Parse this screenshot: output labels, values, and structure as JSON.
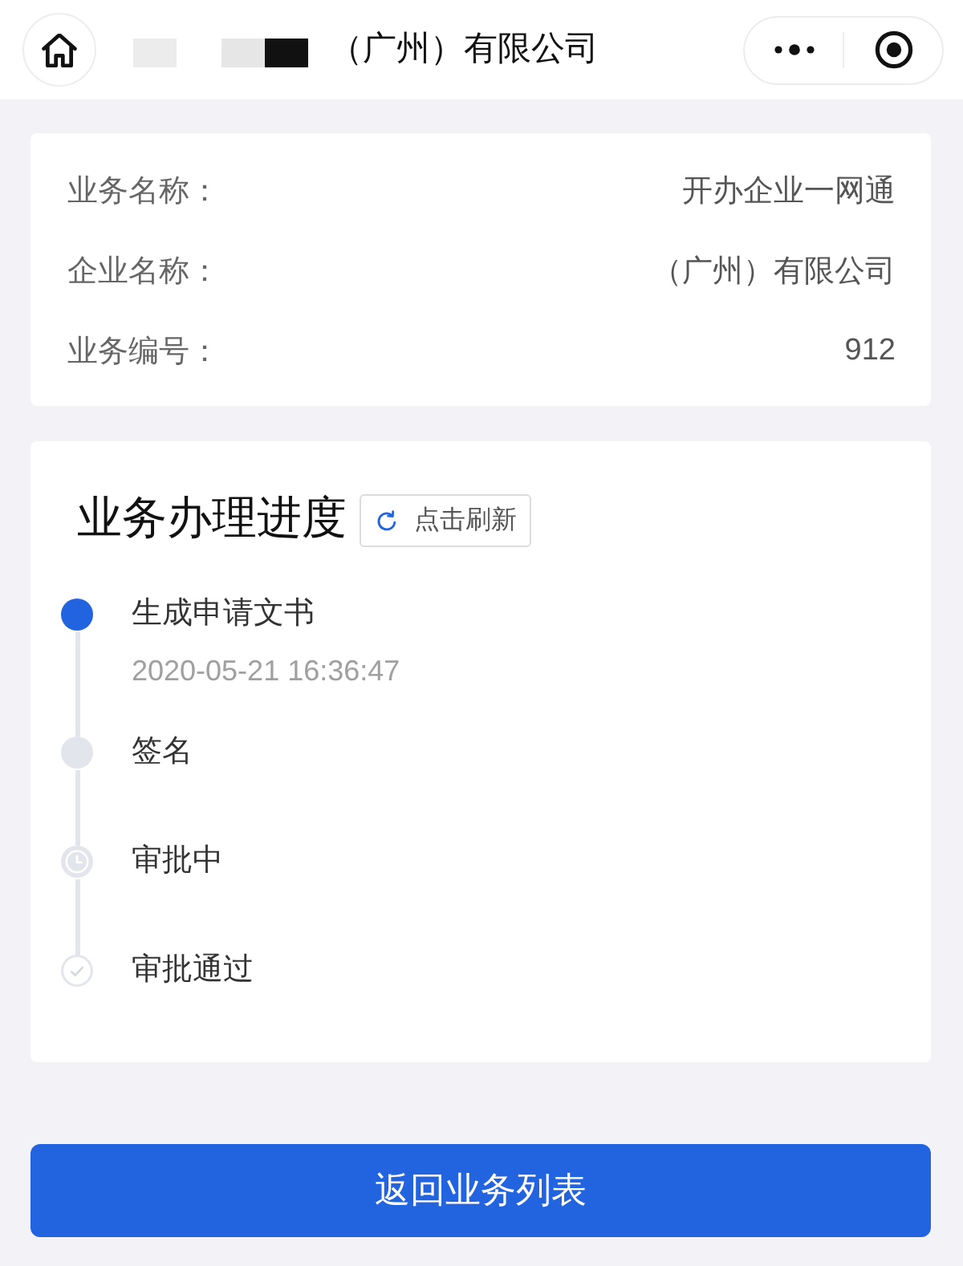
{
  "header": {
    "title": "（广州）有限公司"
  },
  "info": [
    {
      "label": "业务名称：",
      "value": "开办企业一网通"
    },
    {
      "label": "企业名称：",
      "value": "（广州）有限公司"
    },
    {
      "label": "业务编号：",
      "value": "912"
    }
  ],
  "progress": {
    "title": "业务办理进度",
    "refresh": "点击刷新",
    "steps": [
      {
        "kind": "active",
        "name": "生成申请文书",
        "time": "2020-05-21 16:36:47"
      },
      {
        "kind": "dot",
        "name": "签名"
      },
      {
        "kind": "clock",
        "name": "审批中"
      },
      {
        "kind": "check",
        "name": "审批通过"
      }
    ]
  },
  "button": "返回业务列表"
}
